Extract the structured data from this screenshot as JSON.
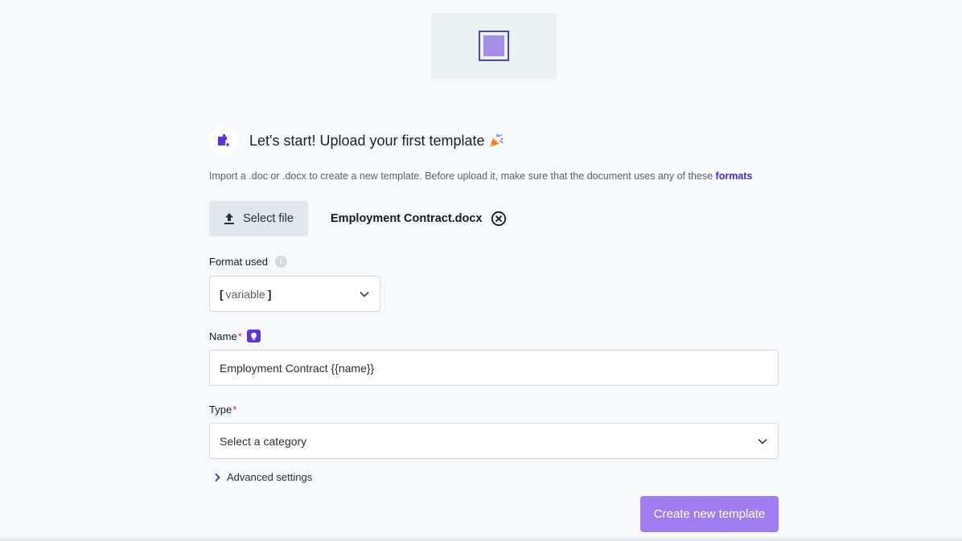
{
  "header": {
    "title": "Let's start! Upload your first template",
    "icon": "template-add-icon",
    "emoji_icon": "party-popper-icon"
  },
  "subtitle": {
    "text": "Import a .doc or .docx to create a new template. Before upload it, make sure that the document uses any of these ",
    "link": "formats"
  },
  "upload": {
    "select_label": "Select file",
    "file_name": "Employment Contract.docx"
  },
  "format": {
    "label": "Format used",
    "value_open": "[",
    "value_word": "variable",
    "value_close": "]"
  },
  "name_field": {
    "label": "Name",
    "required_mark": "*",
    "value": "Employment Contract {{name}}"
  },
  "type_field": {
    "label": "Type",
    "required_mark": "*",
    "placeholder": "Select a category"
  },
  "advanced": {
    "label": "Advanced settings"
  },
  "actions": {
    "create_label": "Create new template"
  },
  "colors": {
    "accent": "#5b35d8",
    "link": "#4a2bc4",
    "primary_button": "#9f7ff0",
    "required": "#e0245e"
  }
}
